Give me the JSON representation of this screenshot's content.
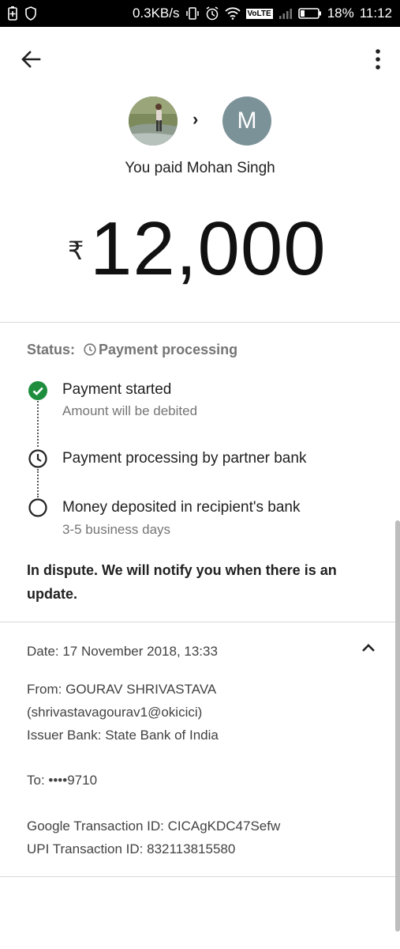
{
  "status_bar": {
    "speed": "0.3KB/s",
    "volte": "VoLTE",
    "battery": "18%",
    "time": "11:12"
  },
  "header": {
    "back_icon": "arrow-back-icon",
    "menu_icon": "more-vert-icon"
  },
  "payee": {
    "initial": "M",
    "paid_text": "You paid Mohan Singh"
  },
  "payment": {
    "currency_symbol": "₹",
    "amount": "12,000"
  },
  "status": {
    "label": "Status:",
    "value": "Payment processing",
    "steps": [
      {
        "title": "Payment started",
        "subtitle": "Amount will be debited",
        "state": "done"
      },
      {
        "title": "Payment processing by partner bank",
        "subtitle": "",
        "state": "in-progress"
      },
      {
        "title": "Money deposited in recipient's bank",
        "subtitle": "3-5 business days",
        "state": "pending"
      }
    ],
    "dispute_message": "In dispute. We will notify you when there is an update."
  },
  "details": {
    "date": "Date: 17 November 2018, 13:33",
    "from": "From: GOURAV  SHRIVASTAVA",
    "from_upi": "(shrivastavagourav1@okicici)",
    "issuer_bank": "Issuer Bank: State Bank of India",
    "to": "To: ••••9710",
    "google_txn": "Google Transaction ID: CICAgKDC47Sefw",
    "upi_txn": "UPI Transaction ID: 832113815580"
  },
  "colors": {
    "check_green": "#1e8e3e",
    "avatar_m_bg": "#7c9299"
  }
}
